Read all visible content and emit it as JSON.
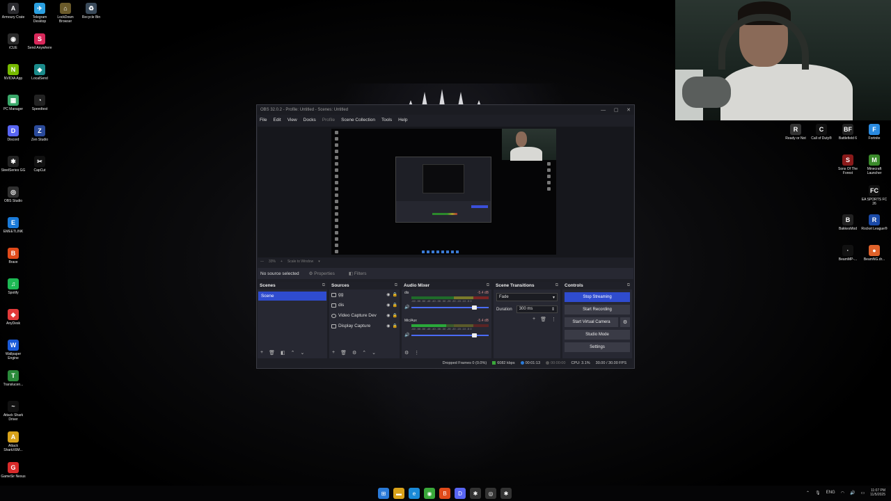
{
  "desktop_icons_left": [
    {
      "label": "Armoury Crate",
      "color": "#2b2b2f",
      "glyph": "A"
    },
    {
      "label": "Telegram Desktop",
      "color": "#2a9fe0",
      "glyph": "✈"
    },
    {
      "label": "LockDown Browser",
      "color": "#6a5a2a",
      "glyph": "⌂"
    },
    {
      "label": "Recycle Bin",
      "color": "#3a4a5a",
      "glyph": "♻"
    },
    {
      "label": "iCUE",
      "color": "#2a2a2a",
      "glyph": "◉"
    },
    {
      "label": "Send Anywhere",
      "color": "#d8285a",
      "glyph": "S"
    },
    {
      "label": "NVIDIA App",
      "color": "#76b900",
      "glyph": "N"
    },
    {
      "label": "LocalSend",
      "color": "#1a8a8a",
      "glyph": "◆"
    },
    {
      "label": "PC Manager",
      "color": "#3aa86a",
      "glyph": "▦"
    },
    {
      "label": "Speedtest",
      "color": "#222",
      "glyph": "◔"
    },
    {
      "label": "Discord",
      "color": "#5865f2",
      "glyph": "D"
    },
    {
      "label": "Zen Studio",
      "color": "#2a4a9a",
      "glyph": "Z"
    },
    {
      "label": "SteelSeries GG",
      "color": "#222",
      "glyph": "✱"
    },
    {
      "label": "CapCut",
      "color": "#111",
      "glyph": "✂"
    },
    {
      "label": "OBS Studio",
      "color": "#303030",
      "glyph": "◎"
    },
    {
      "label": "EMEETLINK",
      "color": "#1a7ad8",
      "glyph": "E"
    },
    {
      "label": "Brave",
      "color": "#e04a1a",
      "glyph": "B"
    },
    {
      "label": "Spotify",
      "color": "#1db954",
      "glyph": "♫"
    },
    {
      "label": "AnyDesk",
      "color": "#e23a3a",
      "glyph": "◆"
    },
    {
      "label": "Wallpaper Engine",
      "color": "#1a5ad8",
      "glyph": "W"
    },
    {
      "label": "Translucen...",
      "color": "#2a8a3a",
      "glyph": "T"
    },
    {
      "label": "Attack Shark Driver",
      "color": "#111",
      "glyph": "~"
    },
    {
      "label": "Attack SharkX6M...",
      "color": "#d8a21a",
      "glyph": "A"
    },
    {
      "label": "GameSir Nexus",
      "color": "#d82a2a",
      "glyph": "G"
    }
  ],
  "desktop_icons_right": [
    {
      "label": "Ready or Not",
      "color": "#333",
      "glyph": "R"
    },
    {
      "label": "Call of Duty®",
      "color": "#111",
      "glyph": "C"
    },
    {
      "label": "Battlefield 6",
      "color": "#222",
      "glyph": "BF"
    },
    {
      "label": "Fortnite",
      "color": "#2a8ae0",
      "glyph": "F"
    },
    {
      "label": "Sons Of The Forest",
      "color": "#8a1a1a",
      "glyph": "S"
    },
    {
      "label": "Minecraft Launcher",
      "color": "#3a8a2a",
      "glyph": "M"
    },
    {
      "label": "EA SPORTS FC 26",
      "color": "#111",
      "glyph": "FC"
    },
    {
      "label": "BakkesMod",
      "color": "#222",
      "glyph": "B"
    },
    {
      "label": "Rocket League®",
      "color": "#1a4aa8",
      "glyph": "R"
    },
    {
      "label": "BeamMP-...",
      "color": "#111",
      "glyph": "·"
    },
    {
      "label": "BeamNG.dr...",
      "color": "#e0622a",
      "glyph": "●"
    }
  ],
  "obs": {
    "title": "OBS 32.0.2 - Profile: Untitled - Scenes: Untitled",
    "menu": [
      "File",
      "Edit",
      "View",
      "Docks",
      "Profile",
      "Scene Collection",
      "Tools",
      "Help"
    ],
    "zoom": {
      "percent": "33%",
      "mode": "Scale to Window"
    },
    "selected_source_text": "No source selected",
    "properties_label": "Properties",
    "filters_label": "Filters",
    "scenes": {
      "title": "Scenes",
      "items": [
        "Scene"
      ]
    },
    "sources": {
      "title": "Sources",
      "items": [
        "gg",
        "dis",
        "Video Capture Dev",
        "Display Capture"
      ]
    },
    "mixer": {
      "title": "Audio Mixer",
      "tracks": [
        {
          "name": "dis",
          "db": "-5.4 dB",
          "volume": 0.82
        },
        {
          "name": "Mic/Aux",
          "db": "-5.4 dB",
          "volume": 0.82
        }
      ],
      "ticks": "-60 -55 -50 -45 -40 -35 -30 -25 -20 -15 -10 -5 0"
    },
    "transitions": {
      "title": "Scene Transitions",
      "selected": "Fade",
      "duration_label": "Duration",
      "duration_value": "300 ms"
    },
    "controls": {
      "title": "Controls",
      "stop_streaming": "Stop Streaming",
      "start_recording": "Start Recording",
      "start_virtual_camera": "Start Virtual Camera",
      "studio_mode": "Studio Mode",
      "settings": "Settings"
    },
    "status": {
      "dropped_frames": "Dropped Frames 0 (0.0%)",
      "bitrate": "6082 kbps",
      "stream_time": "00:01:13",
      "rec_time": "00:00:00",
      "cpu": "CPU: 3.1%",
      "fps": "30.00 / 30.00 FPS"
    }
  },
  "taskbar": {
    "apps": [
      {
        "name": "start",
        "color": "#2a7ad8",
        "glyph": "⊞"
      },
      {
        "name": "file-explorer",
        "color": "#d8a21a",
        "glyph": "▬"
      },
      {
        "name": "edge",
        "color": "#1a8ad8",
        "glyph": "e"
      },
      {
        "name": "chrome",
        "color": "#3aa83a",
        "glyph": "◉"
      },
      {
        "name": "brave",
        "color": "#e04a1a",
        "glyph": "B"
      },
      {
        "name": "discord",
        "color": "#5865f2",
        "glyph": "D"
      },
      {
        "name": "steelseries",
        "color": "#333",
        "glyph": "✱"
      },
      {
        "name": "obs",
        "color": "#333",
        "glyph": "◎"
      },
      {
        "name": "steelseries-2",
        "color": "#333",
        "glyph": "✱"
      }
    ],
    "language": "ENG",
    "time": "11:07 PM",
    "date": "11/5/2025"
  }
}
